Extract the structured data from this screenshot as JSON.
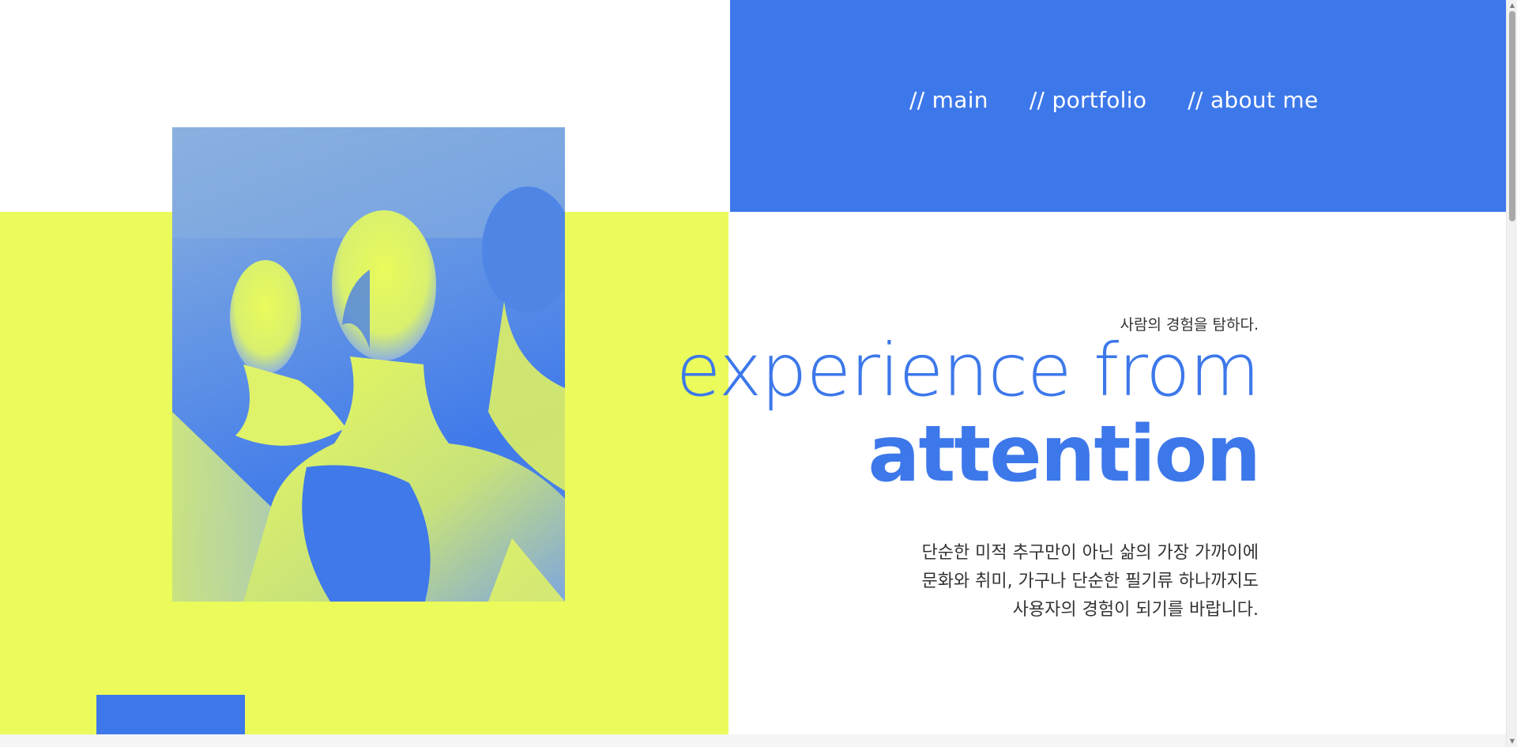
{
  "nav": {
    "items": [
      {
        "label": "// main"
      },
      {
        "label": "// portfolio"
      },
      {
        "label": "// about me"
      }
    ]
  },
  "hero": {
    "subtitle": "사람의 경험을 탐하다.",
    "headline_line1": "experience from",
    "headline_line2": "attention",
    "description": [
      "단순한 미적 추구만이 아닌 삶의 가장 가까이에",
      "문화와 취미, 가구나 단순한 필기류 하나까지도",
      "사용자의 경험이 되기를 바랍니다."
    ],
    "image": {
      "subject": "duotone mannequin figures"
    }
  },
  "colors": {
    "accent_blue": "#3d78ea",
    "lime": "#eafb5b",
    "text_dark": "#333333",
    "background": "#ffffff"
  },
  "scrollbar": {
    "up_icon": "chevron-up-icon",
    "down_icon": "chevron-down-icon"
  }
}
